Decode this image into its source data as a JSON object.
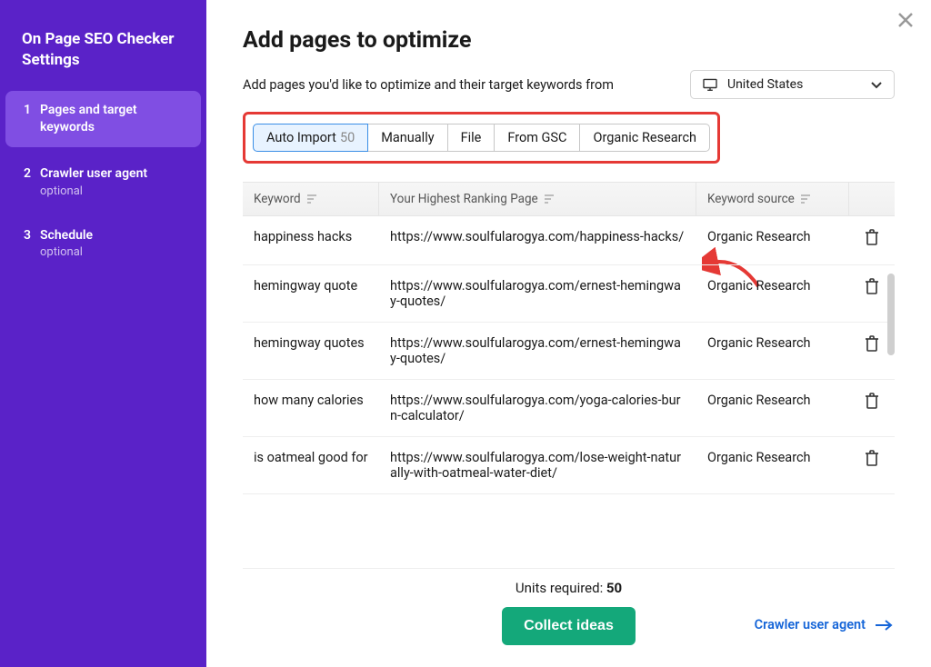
{
  "sidebar": {
    "title": "On Page SEO Checker Settings",
    "steps": [
      {
        "num": "1",
        "label": "Pages and target keywords",
        "sub": "",
        "active": true
      },
      {
        "num": "2",
        "label": "Crawler user agent",
        "sub": "optional",
        "active": false
      },
      {
        "num": "3",
        "label": "Schedule",
        "sub": "optional",
        "active": false
      }
    ]
  },
  "header": {
    "title": "Add pages to optimize",
    "subtitle": "Add pages you'd like to optimize and their target keywords from",
    "country": "United States"
  },
  "tabs": [
    {
      "label": "Auto Import",
      "count": "50",
      "active": true
    },
    {
      "label": "Manually"
    },
    {
      "label": "File"
    },
    {
      "label": "From GSC"
    },
    {
      "label": "Organic Research"
    }
  ],
  "table": {
    "head_keyword": "Keyword",
    "head_page": "Your Highest Ranking Page",
    "head_source": "Keyword source",
    "rows": [
      {
        "keyword": "happiness hacks",
        "page": "https://www.soulfularogya.com/happiness-hacks/",
        "source": "Organic Research"
      },
      {
        "keyword": "hemingway quote",
        "page": "https://www.soulfularogya.com/ernest-hemingway-quotes/",
        "source": "Organic Research"
      },
      {
        "keyword": "hemingway quotes",
        "page": "https://www.soulfularogya.com/ernest-hemingway-quotes/",
        "source": "Organic Research"
      },
      {
        "keyword": "how many calories",
        "page": "https://www.soulfularogya.com/yoga-calories-burn-calculator/",
        "source": "Organic Research"
      },
      {
        "keyword": "is oatmeal good for",
        "page": "https://www.soulfularogya.com/lose-weight-naturally-with-oatmeal-water-diet/",
        "source": "Organic Research"
      }
    ]
  },
  "footer": {
    "units_label": "Units required: ",
    "units_value": "50",
    "collect_label": "Collect ideas",
    "next_label": "Crawler user agent"
  }
}
